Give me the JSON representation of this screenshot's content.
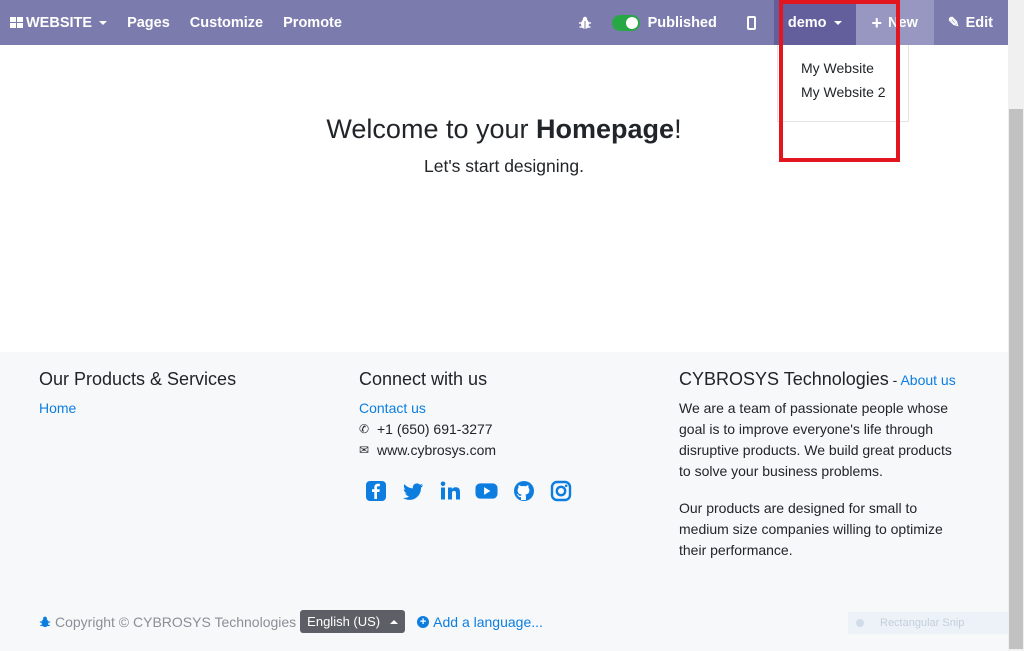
{
  "navbar": {
    "website_label": "WEBSITE",
    "pages_label": "Pages",
    "customize_label": "Customize",
    "promote_label": "Promote",
    "published_label": "Published",
    "published_on": true,
    "user_label": "demo",
    "new_label": "New",
    "edit_label": "Edit"
  },
  "website_dropdown": {
    "items": [
      "My Website",
      "My Website 2"
    ]
  },
  "hero": {
    "title_prefix": "Welcome to your ",
    "title_bold": "Homepage",
    "title_suffix": "!",
    "subtitle": "Let's start designing."
  },
  "footer": {
    "col1": {
      "heading": "Our Products & Services",
      "link": "Home"
    },
    "col2": {
      "heading": "Connect with us",
      "contact_link": "Contact us",
      "phone": "+1 (650) 691-3277",
      "website": "www.cybrosys.com",
      "social_icons": [
        "facebook-icon",
        "twitter-icon",
        "linkedin-icon",
        "youtube-icon",
        "github-icon",
        "instagram-icon"
      ]
    },
    "col3": {
      "heading": "CYBROSYS Technologies",
      "separator": " - ",
      "about_link": "About us",
      "para1": "We are a team of passionate people whose goal is to improve everyone's life through disruptive products. We build great products to solve your business problems.",
      "para2": "Our products are designed for small to medium size companies willing to optimize their performance."
    },
    "copyright": "Copyright © CYBROSYS Technologies",
    "language": "English (US)",
    "add_language": "Add a language..."
  },
  "overlay": {
    "snip_label": "Rectangular Snip"
  },
  "colors": {
    "navbar": "#7c7bad",
    "accent_link": "#0d7ee0",
    "highlight_box": "#e3151f",
    "toggle_on": "#28a745"
  }
}
